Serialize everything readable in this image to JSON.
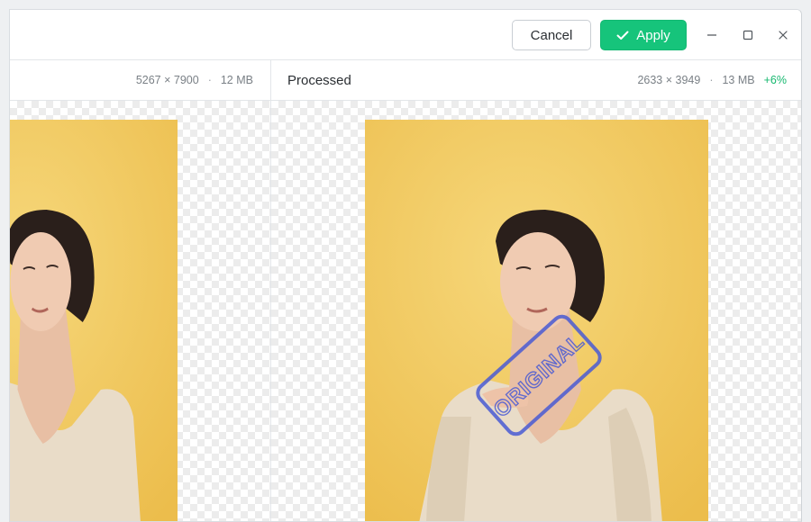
{
  "toolbar": {
    "cancel_label": "Cancel",
    "apply_label": "Apply",
    "apply_icon": "check-icon",
    "window_controls": [
      "minimize-icon",
      "maximize-icon",
      "close-icon"
    ]
  },
  "original": {
    "dimensions": "5267 × 7900",
    "separator": "·",
    "size": "12 MB"
  },
  "processed": {
    "title": "Processed",
    "dimensions": "2633 × 3949",
    "separator": "·",
    "size": "13 MB",
    "size_delta": "+6%"
  },
  "watermark": {
    "text": "ORIGINAL"
  },
  "colors": {
    "accent": "#16c47b",
    "delta_positive": "#16b86f",
    "photo_background": "#f2c95d",
    "watermark": "#4a5bd4"
  }
}
